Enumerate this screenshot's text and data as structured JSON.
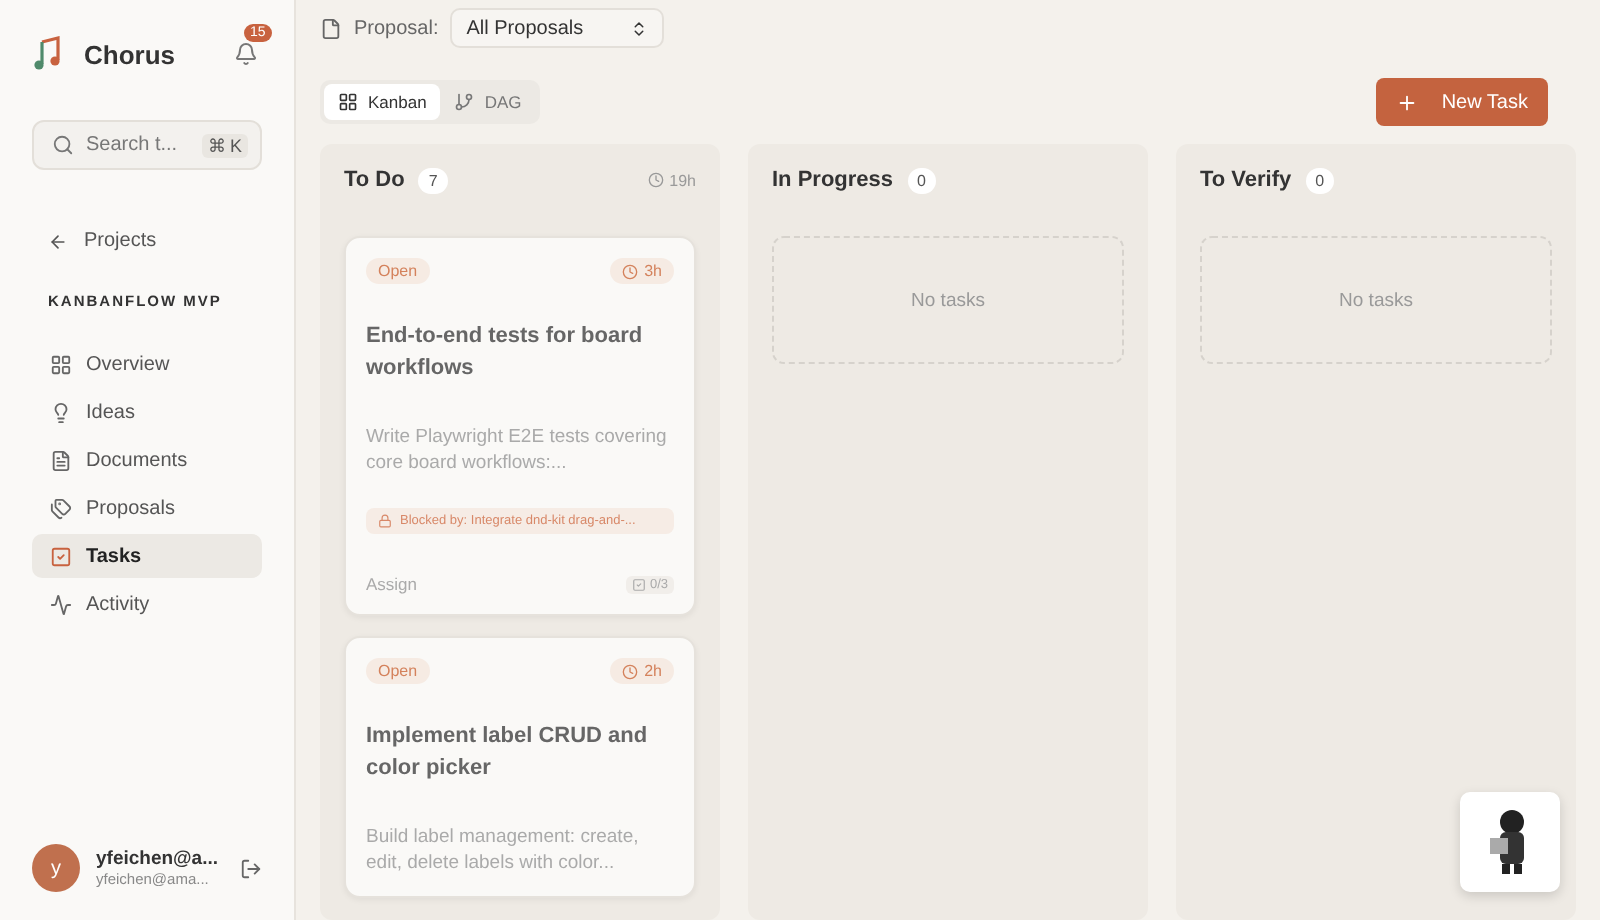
{
  "app": {
    "name": "Chorus",
    "notification_count": "15"
  },
  "search": {
    "placeholder": "Search t...",
    "keys": [
      "⌘",
      "K"
    ]
  },
  "back": {
    "label": "Projects"
  },
  "project": {
    "name": "KANBANFLOW MVP"
  },
  "nav": [
    {
      "label": "Overview",
      "selected": false
    },
    {
      "label": "Ideas",
      "selected": false
    },
    {
      "label": "Documents",
      "selected": false
    },
    {
      "label": "Proposals",
      "selected": false
    },
    {
      "label": "Tasks",
      "selected": true
    },
    {
      "label": "Activity",
      "selected": false
    }
  ],
  "user": {
    "avatar": "y",
    "name": "yfeichen@a...",
    "email": "yfeichen@ama..."
  },
  "filter": {
    "label": "Proposal:",
    "value": "All Proposals"
  },
  "views": [
    {
      "label": "Kanban",
      "selected": true
    },
    {
      "label": "DAG",
      "selected": false
    }
  ],
  "new_task": {
    "label": "New Task"
  },
  "columns": [
    {
      "title": "To Do",
      "count": "7",
      "duration": "19h",
      "tasks": [
        {
          "status": "Open",
          "estimate": "3h",
          "title": "End-to-end tests for board workflows",
          "description": "Write Playwright E2E tests covering core board workflows:...",
          "blocked": "Blocked by: Integrate dnd-kit drag-and-...",
          "assign": "Assign",
          "checklist": "0/3"
        },
        {
          "status": "Open",
          "estimate": "2h",
          "title": "Implement label CRUD and color picker",
          "description": "Build label management: create, edit, delete labels with color..."
        }
      ]
    },
    {
      "title": "In Progress",
      "count": "0",
      "empty": "No tasks"
    },
    {
      "title": "To Verify",
      "count": "0",
      "empty": "No tasks"
    }
  ]
}
